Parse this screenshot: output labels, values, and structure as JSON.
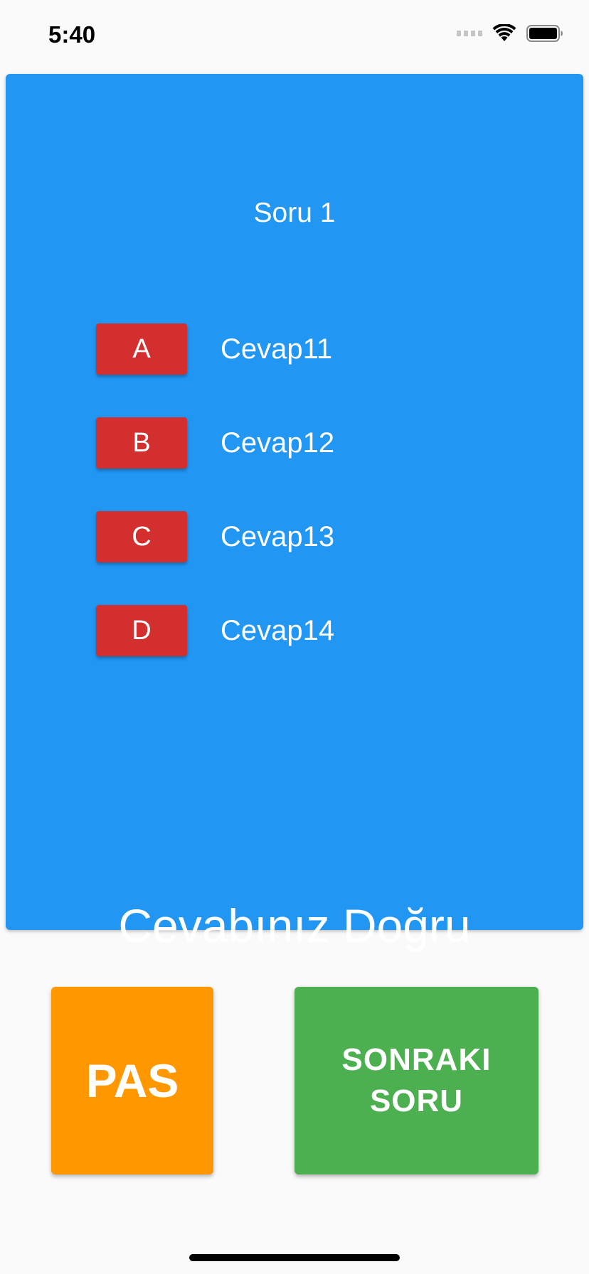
{
  "status_bar": {
    "time": "5:40",
    "icons": [
      "signal-icon",
      "wifi-icon",
      "battery-icon"
    ]
  },
  "quiz": {
    "question_title": "Soru 1",
    "answers": [
      {
        "letter": "A",
        "text": "Cevap11"
      },
      {
        "letter": "B",
        "text": "Cevap12"
      },
      {
        "letter": "C",
        "text": "Cevap13"
      },
      {
        "letter": "D",
        "text": "Cevap14"
      }
    ],
    "result": "Cevabınız Doğru"
  },
  "actions": {
    "pass_label": "PAS",
    "next_label_line1": "SONRAKI",
    "next_label_line2": "SORU"
  },
  "colors": {
    "card": "#2196f3",
    "answer_button": "#d32f2f",
    "pass_button": "#ff9800",
    "next_button": "#4caf50",
    "background": "#fafafa"
  }
}
